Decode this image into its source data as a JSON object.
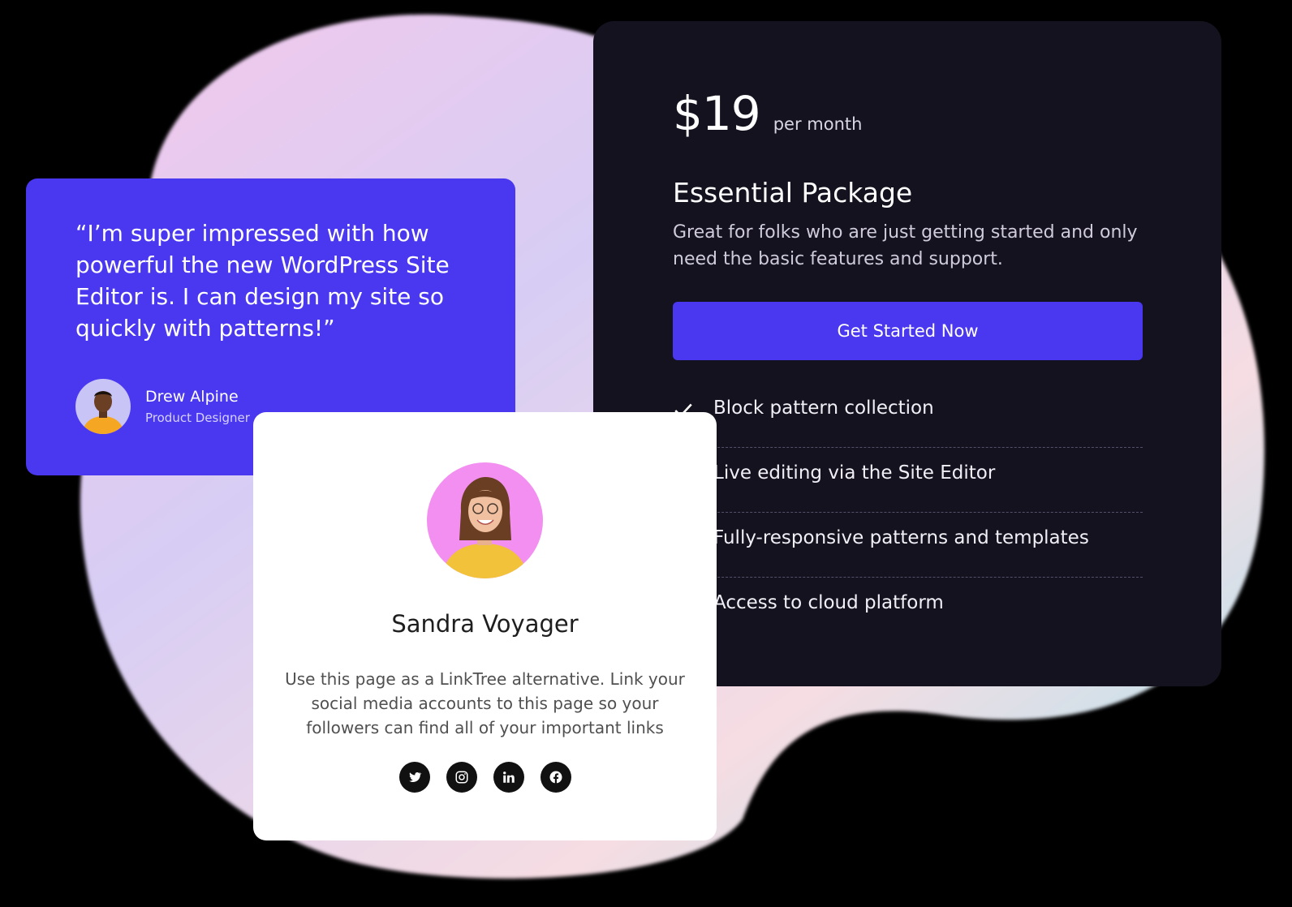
{
  "pricing": {
    "price": "$19",
    "period": "per month",
    "title": "Essential Package",
    "description": "Great for folks who are just getting started and only need the basic features and support.",
    "cta_label": "Get Started Now",
    "features": [
      "Block pattern collection",
      "Live editing via the Site Editor",
      "Fully-responsive patterns and templates",
      "Access to cloud platform"
    ]
  },
  "testimonial": {
    "quote": "“I’m super impressed with how powerful the new WordPress Site Editor is. I can design my site so quickly with patterns!”",
    "author_name": "Drew Alpine",
    "author_role": "Product Designer"
  },
  "profile": {
    "name": "Sandra Voyager",
    "bio": "Use this page as a LinkTree alternative. Link your social media accounts to this page so your followers can find all of your important links",
    "socials": [
      "twitter-icon",
      "instagram-icon",
      "linkedin-icon",
      "facebook-icon"
    ]
  },
  "colors": {
    "accent": "#4a37f0",
    "dark_card": "#15121f",
    "background": "#000000"
  }
}
